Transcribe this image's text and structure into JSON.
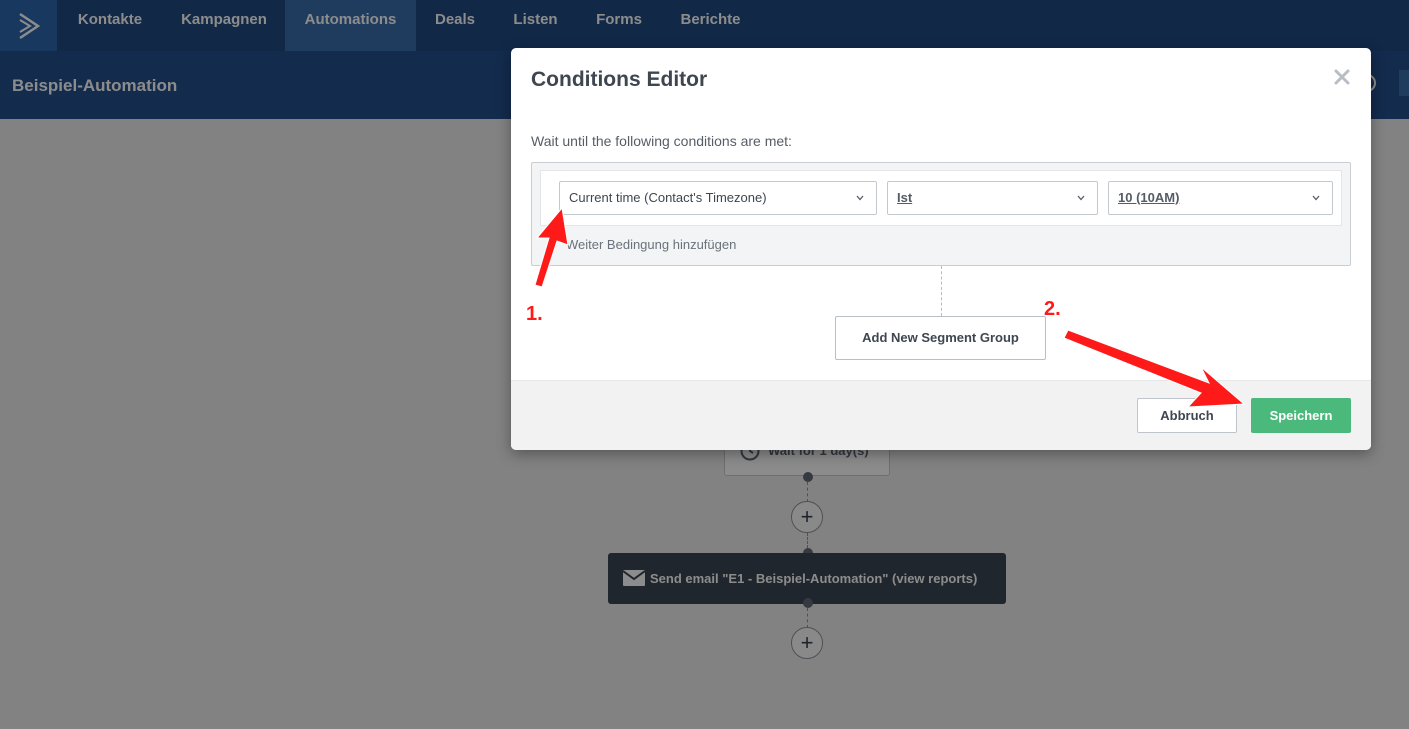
{
  "nav": {
    "items": [
      {
        "label": "Kontakte"
      },
      {
        "label": "Kampagnen"
      },
      {
        "label": "Automations",
        "active": true
      },
      {
        "label": "Deals"
      },
      {
        "label": "Listen"
      },
      {
        "label": "Forms"
      },
      {
        "label": "Berichte"
      }
    ]
  },
  "header": {
    "title": "Beispiel-Automation"
  },
  "canvas": {
    "wait_label": "Wait for 1 day(s)",
    "email_label": "Send email \"E1 - Beispiel-Automation\" (view reports)"
  },
  "modal": {
    "title": "Conditions Editor",
    "instruction": "Wait until the following conditions are met:",
    "condition": {
      "field": "Current time (Contact's Timezone)",
      "operator": "Ist",
      "value": "10 (10AM)"
    },
    "add_condition_label": "Weiter Bedingung hinzufügen",
    "segment_button": "Add New Segment Group",
    "cancel_label": "Abbruch",
    "save_label": "Speichern"
  },
  "annotations": {
    "label_1": "1.",
    "label_2": "2."
  },
  "colors": {
    "nav_bg": "#1f4a82",
    "nav_active": "#3a6eae",
    "save_button": "#4cb97c",
    "annotation_red": "#ff1a1a"
  },
  "icons": [
    "logo-chevron-icon",
    "gear-icon",
    "close-icon",
    "chevron-down-icon",
    "clock-icon",
    "plus-icon",
    "mail-icon"
  ]
}
